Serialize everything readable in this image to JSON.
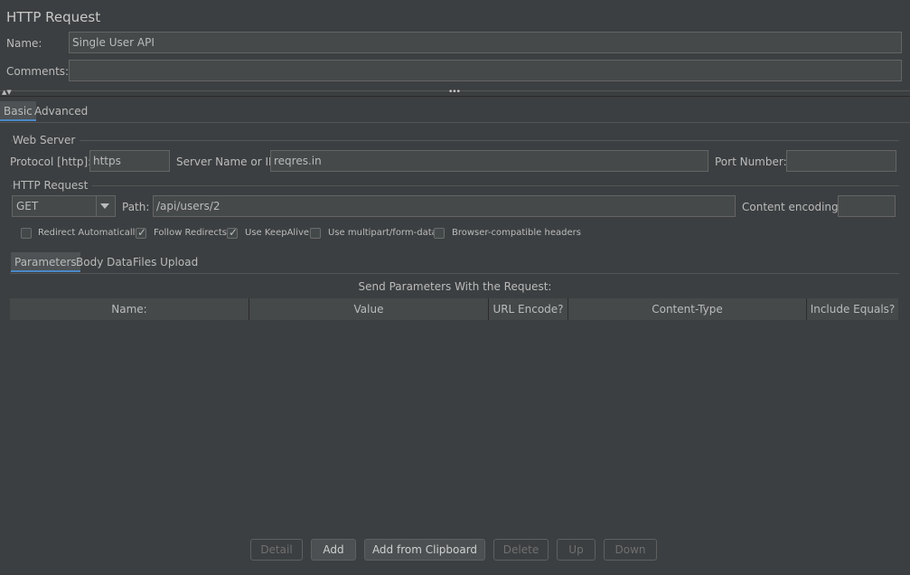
{
  "panel_title": "HTTP Request",
  "name": {
    "label": "Name:",
    "value": "Single User API"
  },
  "comments": {
    "label": "Comments:",
    "value": ""
  },
  "tabs": [
    {
      "label": "Basic",
      "active": true
    },
    {
      "label": "Advanced",
      "active": false
    }
  ],
  "web_server": {
    "title": "Web Server",
    "protocol_label": "Protocol [http]:",
    "protocol_value": "https",
    "server_label": "Server Name or IP:",
    "server_value": "reqres.in",
    "port_label": "Port Number:",
    "port_value": ""
  },
  "http_request": {
    "title": "HTTP Request",
    "method": "GET",
    "path_label": "Path:",
    "path_value": "/api/users/2",
    "encoding_label": "Content encoding:",
    "encoding_value": ""
  },
  "checkboxes": [
    {
      "label": "Redirect Automatically",
      "checked": false
    },
    {
      "label": "Follow Redirects",
      "checked": true
    },
    {
      "label": "Use KeepAlive",
      "checked": true
    },
    {
      "label": "Use multipart/form-data",
      "checked": false
    },
    {
      "label": "Browser-compatible headers",
      "checked": false
    }
  ],
  "subtabs": [
    {
      "label": "Parameters",
      "active": true
    },
    {
      "label": "Body Data",
      "active": false
    },
    {
      "label": "Files Upload",
      "active": false
    }
  ],
  "params_caption": "Send Parameters With the Request:",
  "table_headers": [
    "Name:",
    "Value",
    "URL Encode?",
    "Content-Type",
    "Include Equals?"
  ],
  "buttons": [
    {
      "label": "Detail",
      "enabled": false
    },
    {
      "label": "Add",
      "enabled": true
    },
    {
      "label": "Add from Clipboard",
      "enabled": true
    },
    {
      "label": "Delete",
      "enabled": false
    },
    {
      "label": "Up",
      "enabled": false
    },
    {
      "label": "Down",
      "enabled": false
    }
  ],
  "splitter_handle": "•••",
  "collapse_arrows": "▲▼"
}
